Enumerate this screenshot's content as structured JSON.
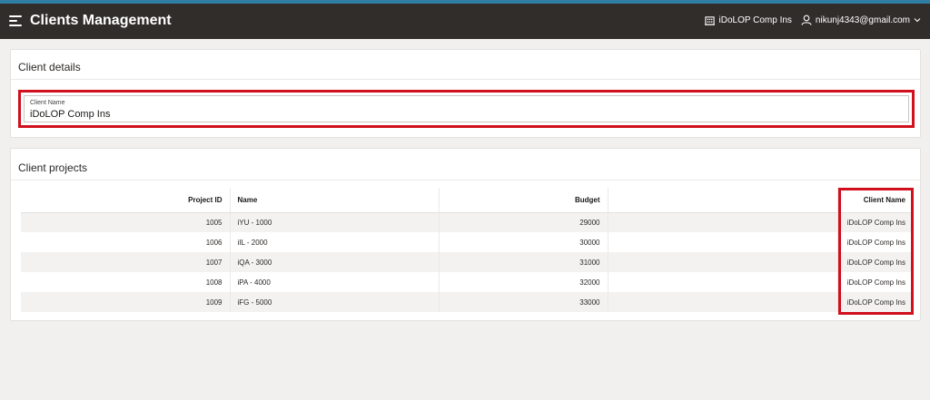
{
  "header": {
    "title": "Clients Management",
    "org_name": "iDoLOP Comp Ins",
    "user_email": "nikunj4343@gmail.com"
  },
  "client_details": {
    "title": "Client details",
    "field_label": "Client Name",
    "field_value": "iDoLOP Comp Ins"
  },
  "client_projects": {
    "title": "Client projects",
    "columns": {
      "project_id": "Project ID",
      "name": "Name",
      "budget": "Budget",
      "client_name": "Client Name"
    },
    "rows": [
      {
        "project_id": "1005",
        "name": "iYU - 1000",
        "budget": "29000",
        "client_name": "iDoLOP Comp Ins"
      },
      {
        "project_id": "1006",
        "name": "iIL - 2000",
        "budget": "30000",
        "client_name": "iDoLOP Comp Ins"
      },
      {
        "project_id": "1007",
        "name": "iQA - 3000",
        "budget": "31000",
        "client_name": "iDoLOP Comp Ins"
      },
      {
        "project_id": "1008",
        "name": "iPA - 4000",
        "budget": "32000",
        "client_name": "iDoLOP Comp Ins"
      },
      {
        "project_id": "1009",
        "name": "iFG - 5000",
        "budget": "33000",
        "client_name": "iDoLOP Comp Ins"
      }
    ]
  },
  "icons": {
    "menu": "hamburger-menu-icon",
    "org": "building-icon",
    "user": "user-icon",
    "chevron": "chevron-down-icon"
  },
  "colors": {
    "header_bg": "#312d2a",
    "accent": "#2f7ea3",
    "highlight": "#d0101c"
  }
}
